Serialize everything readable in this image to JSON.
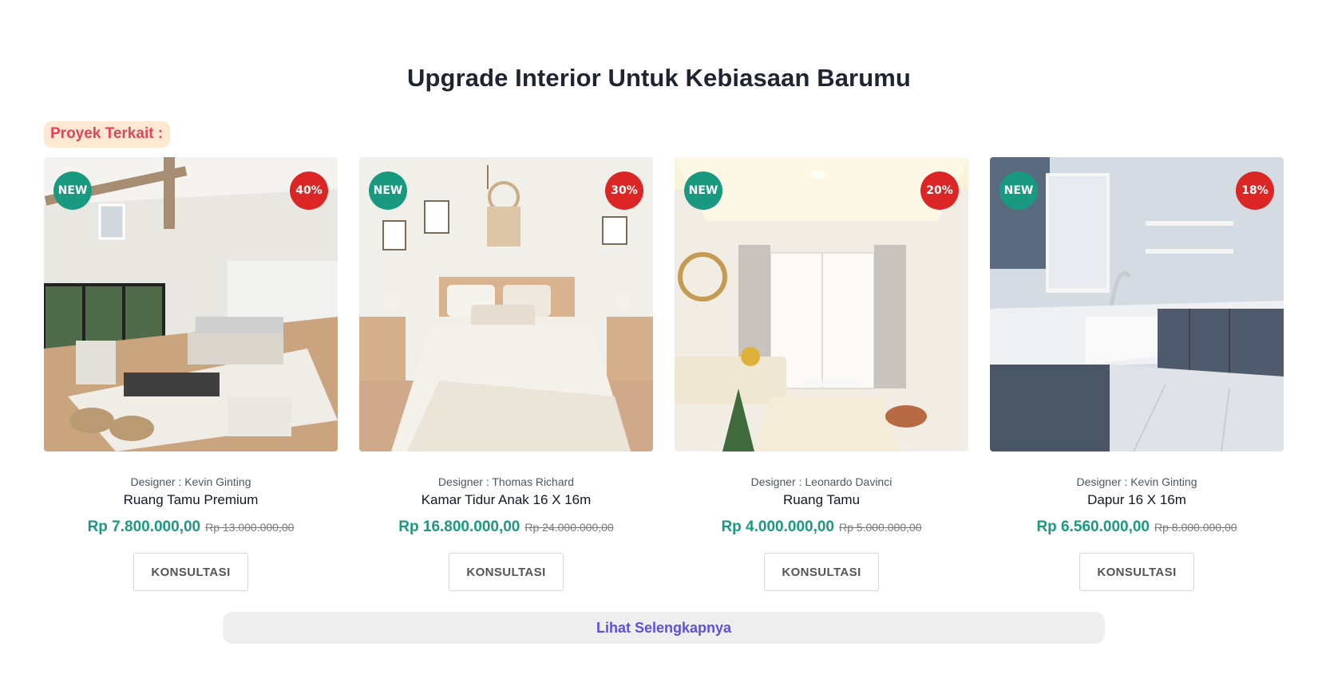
{
  "section": {
    "title": "Upgrade Interior Untuk Kebiasaan Barumu",
    "related_label": "Proyek Terkait :"
  },
  "products": [
    {
      "new_badge": "NEW",
      "discount": "40%",
      "designer": "Designer : Kevin Ginting",
      "name": "Ruang Tamu Premium",
      "price": "Rp 7.800.000,00",
      "old_price": "Rp 13.000.000,00",
      "button": "KONSULTASI",
      "image": "living-room-photo"
    },
    {
      "new_badge": "NEW",
      "discount": "30%",
      "designer": "Designer : Thomas Richard",
      "name": "Kamar Tidur Anak 16 X 16m",
      "price": "Rp 16.800.000,00",
      "old_price": "Rp 24.000.000,00",
      "button": "KONSULTASI",
      "image": "bedroom-photo"
    },
    {
      "new_badge": "NEW",
      "discount": "20%",
      "designer": "Designer : Leonardo Davinci",
      "name": "Ruang Tamu",
      "price": "Rp 4.000.000,00",
      "old_price": "Rp 5.000.000,00",
      "button": "KONSULTASI",
      "image": "living-room-photo"
    },
    {
      "new_badge": "NEW",
      "discount": "18%",
      "designer": "Designer : Kevin Ginting",
      "name": "Dapur 16 X 16m",
      "price": "Rp 6.560.000,00",
      "old_price": "Rp 8.000.000,00",
      "button": "KONSULTASI",
      "image": "kitchen-photo"
    }
  ],
  "see_more_label": "Lihat Selengkapnya",
  "colors": {
    "accent_green": "#199a80",
    "discount_red": "#dc2626",
    "tag_bg": "#fde8d2",
    "tag_text": "#e0455a",
    "link_purple": "#5b50e0"
  }
}
